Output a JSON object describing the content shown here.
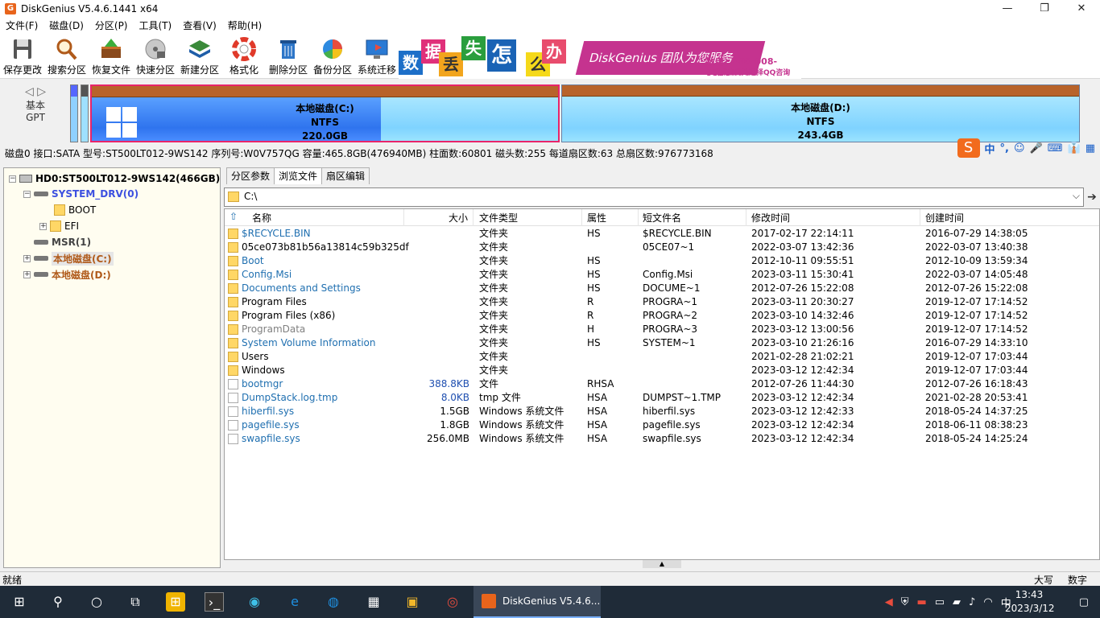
{
  "window": {
    "title": "DiskGenius V5.4.6.1441 x64",
    "app_icon_letter": "G",
    "controls": {
      "minimize": "—",
      "maximize": "❐",
      "close": "✕"
    }
  },
  "menu": [
    "文件(F)",
    "磁盘(D)",
    "分区(P)",
    "工具(T)",
    "查看(V)",
    "帮助(H)"
  ],
  "toolbar": {
    "save": "保存更改",
    "search": "搜索分区",
    "recover": "恢复文件",
    "quick": "快速分区",
    "new": "新建分区",
    "format": "格式化",
    "delete": "删除分区",
    "backup": "备份分区",
    "migrate": "系统迁移"
  },
  "banner": {
    "chars": [
      "数",
      "据",
      "丢",
      "失",
      "怎",
      "么",
      "办"
    ],
    "slogan": "DiskGenius 团队为您服务",
    "phone": "致电：400-008-9958",
    "qq": "或点击此处选择QQ咨询"
  },
  "diskmap": {
    "nav_arrows": "◁ ▷",
    "type_line1": "基本",
    "type_line2": "GPT",
    "partitions": [
      {
        "name": "本地磁盘(C:)",
        "fs": "NTFS",
        "size": "220.0GB",
        "used_fraction": 0.62
      },
      {
        "name": "本地磁盘(D:)",
        "fs": "NTFS",
        "size": "243.4GB",
        "used_fraction": 0
      }
    ]
  },
  "diskinfo": "磁盘0 接口:SATA  型号:ST500LT012-9WS142  序列号:W0V757QG  容量:465.8GB(476940MB)  柱面数:60801  磁头数:255  每道扇区数:63  总扇区数:976773168",
  "ime": {
    "logo": "S",
    "mode": "中",
    "punct": "°,",
    "icons": [
      "☺",
      "🎤",
      "⌨",
      "👔",
      "▦"
    ]
  },
  "tree": {
    "disk": "HD0:ST500LT012-9WS142(466GB)",
    "items": [
      {
        "label": "SYSTEM_DRV(0)"
      },
      {
        "label": "BOOT"
      },
      {
        "label": "EFI"
      },
      {
        "label": "MSR(1)"
      },
      {
        "label": "本地磁盘(C:)"
      },
      {
        "label": "本地磁盘(D:)"
      }
    ]
  },
  "tabs": [
    "分区参数",
    "浏览文件",
    "扇区编辑"
  ],
  "path": "C:\\",
  "columns": [
    "名称",
    "大小",
    "文件类型",
    "属性",
    "短文件名",
    "修改时间",
    "创建时间"
  ],
  "files": [
    {
      "name": "$RECYCLE.BIN",
      "size": "",
      "type": "文件夹",
      "attr": "HS",
      "short": "$RECYCLE.BIN",
      "mtime": "2017-02-17 22:14:11",
      "ctime": "2016-07-29 14:38:05",
      "kind": "folder",
      "color": "#1f6fb0"
    },
    {
      "name": "05ce073b81b56a13814c59b325df",
      "size": "",
      "type": "文件夹",
      "attr": "",
      "short": "05CE07~1",
      "mtime": "2022-03-07 13:42:36",
      "ctime": "2022-03-07 13:40:38",
      "kind": "folder",
      "color": "#000000"
    },
    {
      "name": "Boot",
      "size": "",
      "type": "文件夹",
      "attr": "HS",
      "short": "",
      "mtime": "2012-10-11 09:55:51",
      "ctime": "2012-10-09 13:59:34",
      "kind": "folder",
      "color": "#1f6fb0"
    },
    {
      "name": "Config.Msi",
      "size": "",
      "type": "文件夹",
      "attr": "HS",
      "short": "Config.Msi",
      "mtime": "2023-03-11 15:30:41",
      "ctime": "2022-03-07 14:05:48",
      "kind": "folder",
      "color": "#1f6fb0"
    },
    {
      "name": "Documents and Settings",
      "size": "",
      "type": "文件夹",
      "attr": "HS",
      "short": "DOCUME~1",
      "mtime": "2012-07-26 15:22:08",
      "ctime": "2012-07-26 15:22:08",
      "kind": "folder",
      "color": "#1f6fb0"
    },
    {
      "name": "Program Files",
      "size": "",
      "type": "文件夹",
      "attr": "R",
      "short": "PROGRA~1",
      "mtime": "2023-03-11 20:30:27",
      "ctime": "2019-12-07 17:14:52",
      "kind": "folder",
      "color": "#000000"
    },
    {
      "name": "Program Files (x86)",
      "size": "",
      "type": "文件夹",
      "attr": "R",
      "short": "PROGRA~2",
      "mtime": "2023-03-10 14:32:46",
      "ctime": "2019-12-07 17:14:52",
      "kind": "folder",
      "color": "#000000"
    },
    {
      "name": "ProgramData",
      "size": "",
      "type": "文件夹",
      "attr": "H",
      "short": "PROGRA~3",
      "mtime": "2023-03-12 13:00:56",
      "ctime": "2019-12-07 17:14:52",
      "kind": "folder",
      "color": "#808080"
    },
    {
      "name": "System Volume Information",
      "size": "",
      "type": "文件夹",
      "attr": "HS",
      "short": "SYSTEM~1",
      "mtime": "2023-03-10 21:26:16",
      "ctime": "2016-07-29 14:33:10",
      "kind": "folder",
      "color": "#1f6fb0"
    },
    {
      "name": "Users",
      "size": "",
      "type": "文件夹",
      "attr": "",
      "short": "",
      "mtime": "2021-02-28 21:02:21",
      "ctime": "2019-12-07 17:03:44",
      "kind": "folder",
      "color": "#000000"
    },
    {
      "name": "Windows",
      "size": "",
      "type": "文件夹",
      "attr": "",
      "short": "",
      "mtime": "2023-03-12 12:42:34",
      "ctime": "2019-12-07 17:03:44",
      "kind": "folder",
      "color": "#000000"
    },
    {
      "name": "bootmgr",
      "size": "388.8KB",
      "type": "文件",
      "attr": "RHSA",
      "short": "",
      "mtime": "2012-07-26 11:44:30",
      "ctime": "2012-07-26 16:18:43",
      "kind": "file",
      "color": "#1f6fb0"
    },
    {
      "name": "DumpStack.log.tmp",
      "size": "8.0KB",
      "type": "tmp 文件",
      "attr": "HSA",
      "short": "DUMPST~1.TMP",
      "mtime": "2023-03-12 12:42:34",
      "ctime": "2021-02-28 20:53:41",
      "kind": "file",
      "color": "#1f6fb0"
    },
    {
      "name": "hiberfil.sys",
      "size": "1.5GB",
      "type": "Windows 系统文件",
      "attr": "HSA",
      "short": "hiberfil.sys",
      "mtime": "2023-03-12 12:42:33",
      "ctime": "2018-05-24 14:37:25",
      "kind": "file",
      "color": "#1f6fb0"
    },
    {
      "name": "pagefile.sys",
      "size": "1.8GB",
      "type": "Windows 系统文件",
      "attr": "HSA",
      "short": "pagefile.sys",
      "mtime": "2023-03-12 12:42:34",
      "ctime": "2018-06-11 08:38:23",
      "kind": "file",
      "color": "#1f6fb0"
    },
    {
      "name": "swapfile.sys",
      "size": "256.0MB",
      "type": "Windows 系统文件",
      "attr": "HSA",
      "short": "swapfile.sys",
      "mtime": "2023-03-12 12:42:34",
      "ctime": "2018-05-24 14:25:24",
      "kind": "file",
      "color": "#1f6fb0"
    }
  ],
  "status": {
    "left": "就绪",
    "caps": "大写",
    "num": "数字"
  },
  "taskbar": {
    "active_app": "DiskGenius V5.4.6...",
    "tray_lang": "中",
    "time": "13:43",
    "date": "2023/3/12"
  }
}
